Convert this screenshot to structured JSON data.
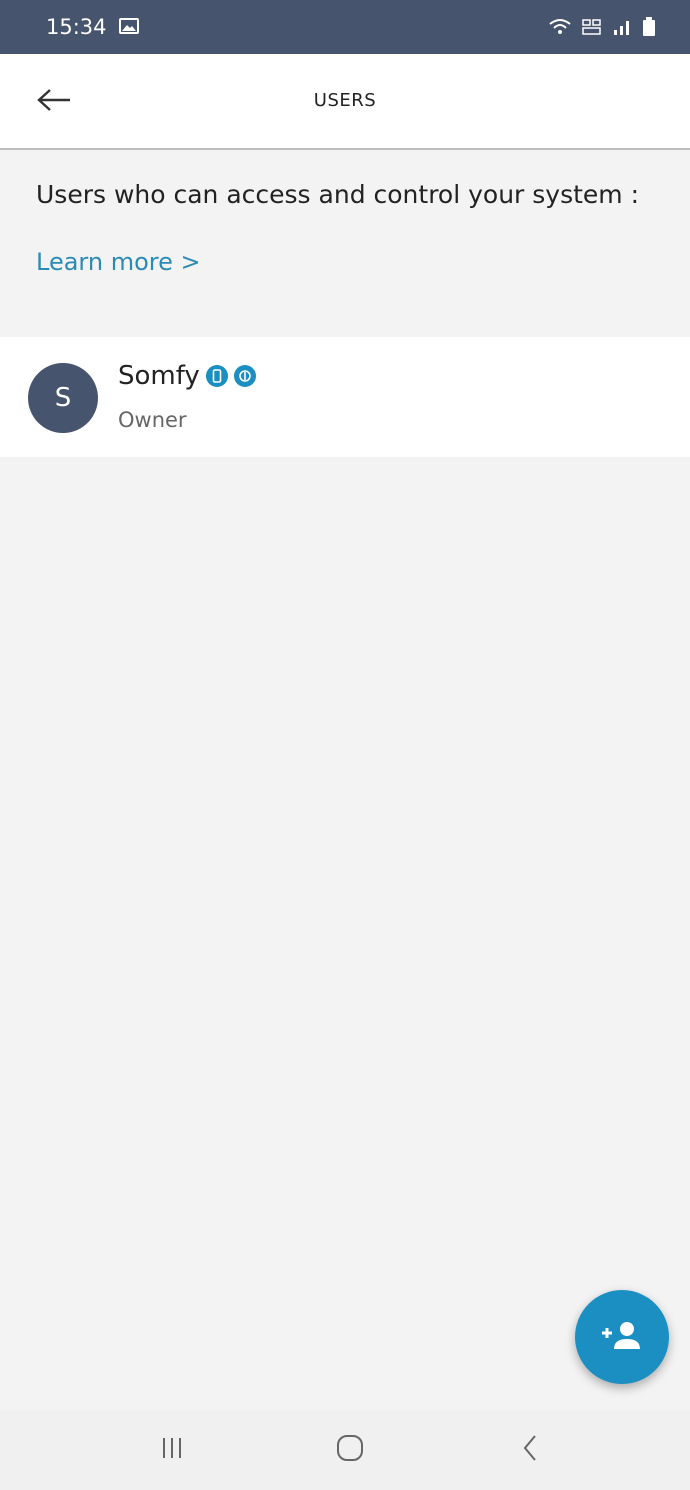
{
  "status_bar": {
    "time": "15:34",
    "icons": [
      "image-notification-icon",
      "wifi-icon",
      "volte-icon",
      "signal-icon",
      "battery-icon"
    ]
  },
  "header": {
    "title": "USERS",
    "back_icon": "arrow-left-icon"
  },
  "intro": {
    "text": "Users who can access and control your system :",
    "learn_more": "Learn more >"
  },
  "users": [
    {
      "initial": "S",
      "name": "Somfy",
      "role": "Owner",
      "badges": [
        "phone-badge-icon",
        "power-badge-icon"
      ]
    }
  ],
  "fab": {
    "icon": "add-user-icon"
  },
  "navigation": {
    "items": [
      "recent-apps-icon",
      "home-icon",
      "back-icon"
    ]
  },
  "colors": {
    "status_bar": "#46556d",
    "accent": "#1b8fc1",
    "link": "#2a8bb4",
    "avatar": "#46556d",
    "background": "#f3f3f3"
  }
}
